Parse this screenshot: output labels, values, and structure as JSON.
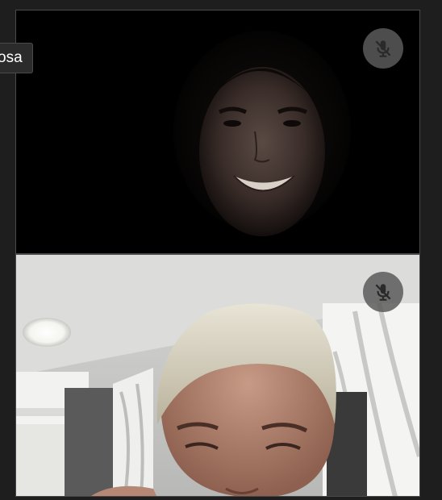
{
  "participant_top": {
    "name_tag": "osa",
    "mic_state": "muted",
    "mute_icon": "mic-off-icon"
  },
  "participant_bottom": {
    "mic_state": "muted",
    "mute_icon": "mic-off-icon"
  },
  "colors": {
    "background": "#1f1f1f",
    "tile_border": "#4a4a4a",
    "mute_button": "#5a5a5a"
  }
}
